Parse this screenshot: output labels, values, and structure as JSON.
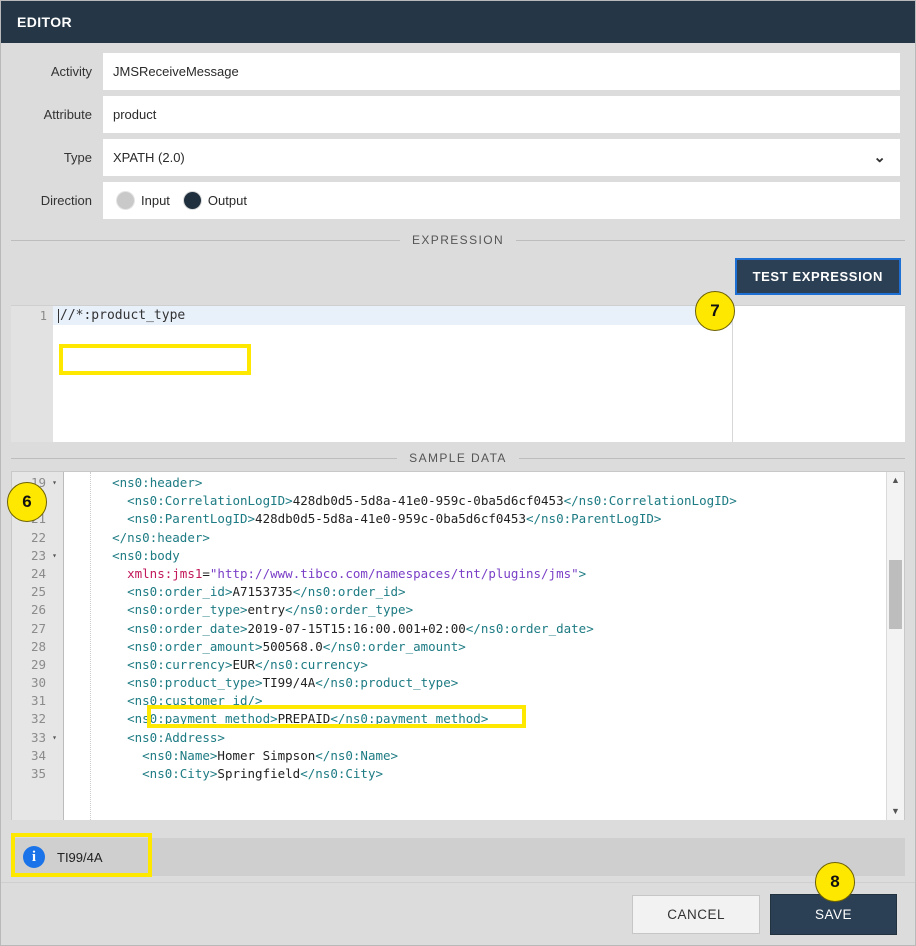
{
  "window": {
    "title": "EDITOR"
  },
  "form": {
    "rows": [
      {
        "label": "Activity",
        "value": "JMSReceiveMessage",
        "kind": "text"
      },
      {
        "label": "Attribute",
        "value": "product",
        "kind": "text"
      },
      {
        "label": "Type",
        "value": "XPATH (2.0)",
        "kind": "select",
        "chevron": "⌄"
      },
      {
        "label": "Direction",
        "value": "Output",
        "kind": "radio"
      }
    ],
    "direction_options": [
      {
        "label": "Input",
        "selected": false
      },
      {
        "label": "Output",
        "selected": true
      }
    ]
  },
  "expression": {
    "legend": "EXPRESSION",
    "test_button": "TEST EXPRESSION",
    "line_number": "1",
    "value": "//*:product_type"
  },
  "sample_data": {
    "legend": "SAMPLE DATA",
    "line_numbers": [
      "19",
      "20",
      "21",
      "22",
      "23",
      "24",
      "25",
      "26",
      "27",
      "28",
      "29",
      "30",
      "31",
      "32",
      "33",
      "34",
      "35"
    ],
    "folds": [
      true,
      false,
      false,
      false,
      true,
      false,
      false,
      false,
      false,
      false,
      false,
      false,
      false,
      false,
      true,
      false,
      false
    ],
    "lines": [
      "  <ns0:header>",
      "    <ns0:CorrelationLogID>428db0d5-5d8a-41e0-959c-0ba5d6cf0453</ns0:CorrelationLogID>",
      "    <ns0:ParentLogID>428db0d5-5d8a-41e0-959c-0ba5d6cf0453</ns0:ParentLogID>",
      "  </ns0:header>",
      "  <ns0:body",
      "    xmlns:jms1=\"http://www.tibco.com/namespaces/tnt/plugins/jms\">",
      "    <ns0:order_id>A7153735</ns0:order_id>",
      "    <ns0:order_type>entry</ns0:order_type>",
      "    <ns0:order_date>2019-07-15T15:16:00.001+02:00</ns0:order_date>",
      "    <ns0:order_amount>500568.0</ns0:order_amount>",
      "    <ns0:currency>EUR</ns0:currency>",
      "    <ns0:product_type>TI99/4A</ns0:product_type>",
      "    <ns0:customer_id/>",
      "    <ns0:payment_method>PREPAID</ns0:payment_method>",
      "    <ns0:Address>",
      "      <ns0:Name>Homer Simpson</ns0:Name>",
      "      <ns0:City>Springfield</ns0:City>"
    ],
    "scroll_up_arrow": "▲",
    "scroll_down_arrow": "▼"
  },
  "result": {
    "icon": "info-icon",
    "icon_glyph": "i",
    "text": "TI99/4A"
  },
  "footer": {
    "cancel_label": "CANCEL",
    "save_label": "SAVE"
  },
  "annotations": {
    "callouts": [
      {
        "number": "6"
      },
      {
        "number": "7"
      },
      {
        "number": "8"
      }
    ]
  },
  "colors": {
    "header_bg": "#253746",
    "accent_button": "#2b4054",
    "focus_outline": "#1d6fd4",
    "highlight": "#ffe800",
    "info_blue": "#1a73e8"
  }
}
